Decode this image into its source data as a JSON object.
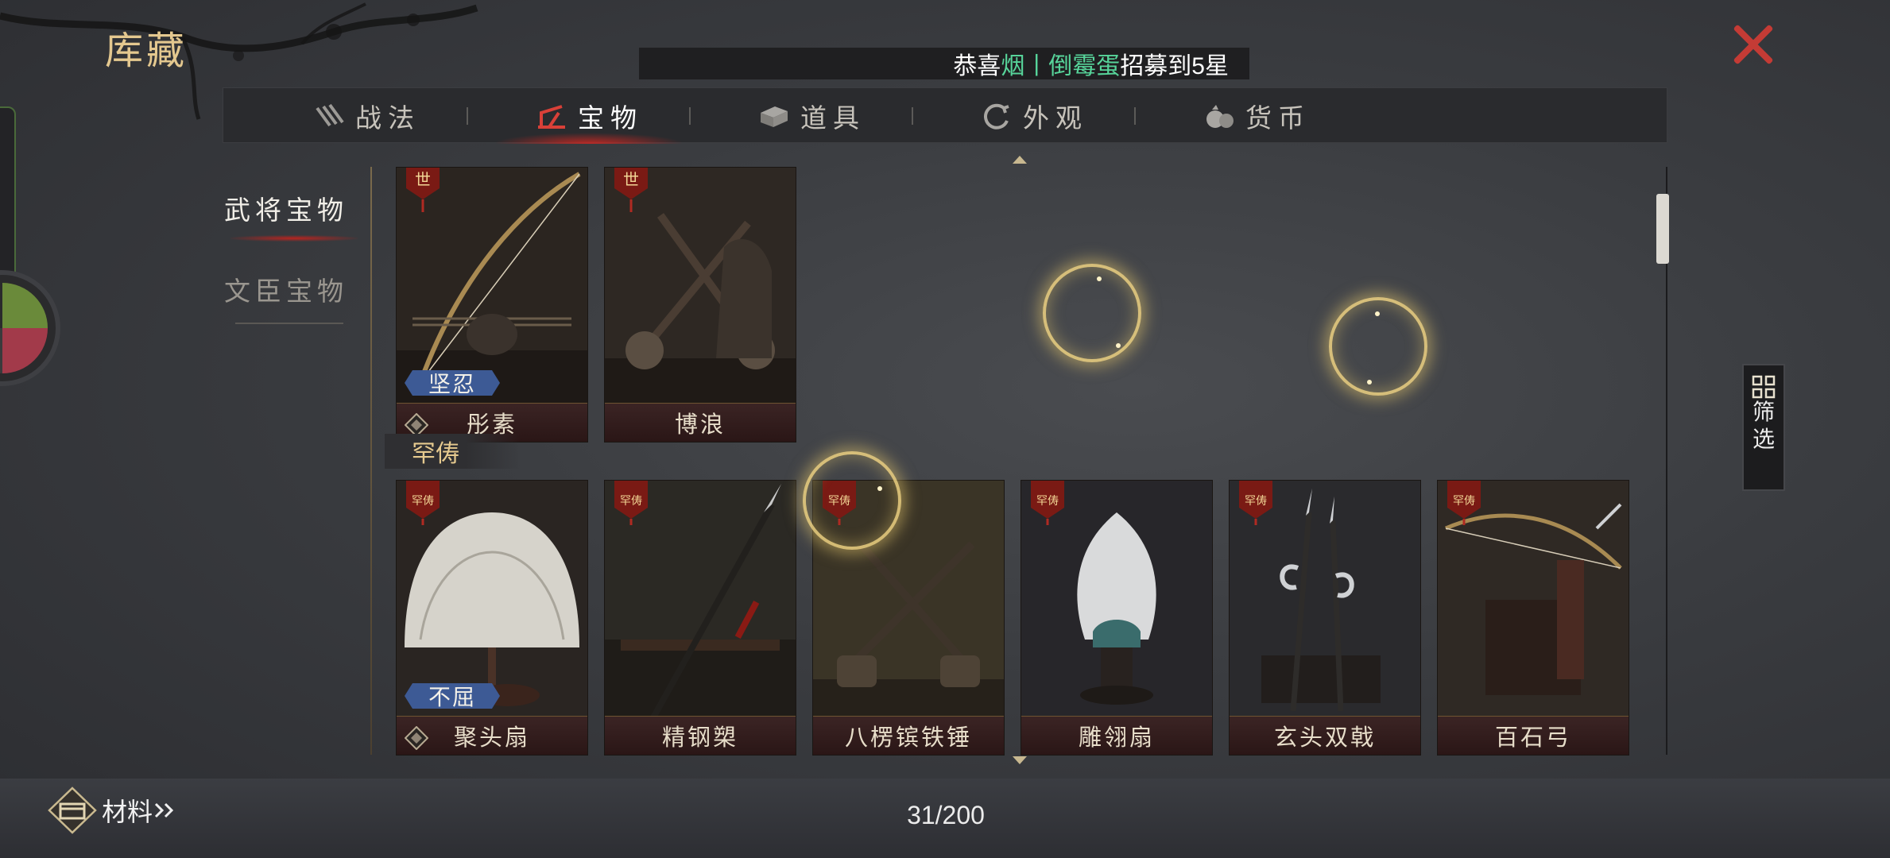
{
  "header": {
    "title": "库藏",
    "close_icon": "close-icon"
  },
  "ticker": {
    "prefix": "恭喜",
    "player": "烟丨倒霉蛋",
    "suffix": "招募到5星"
  },
  "tabs": [
    {
      "label": "战法",
      "icon": "scroll-bundle-icon"
    },
    {
      "label": "宝物",
      "icon": "treasure-icon"
    },
    {
      "label": "道具",
      "icon": "item-box-icon"
    },
    {
      "label": "外观",
      "icon": "swirl-icon"
    },
    {
      "label": "货币",
      "icon": "money-bag-icon"
    }
  ],
  "active_tab": "宝物",
  "sidebar": [
    {
      "label": "武将宝物"
    },
    {
      "label": "文臣宝物"
    }
  ],
  "active_sidebar": "武将宝物",
  "sections": [
    {
      "header": "",
      "rank_badge": "世",
      "items": [
        {
          "name": "彤素",
          "trait": "坚忍",
          "rank_icon": "diamond-rank-icon",
          "art": "bow-icon"
        },
        {
          "name": "博浪",
          "trait": "",
          "rank_icon": "",
          "art": "crossed-hammers-icon"
        }
      ]
    },
    {
      "header": "罕俦",
      "rank_badge": "罕俦",
      "items": [
        {
          "name": "聚头扇",
          "trait": "不屈",
          "rank_icon": "diamond-rank-icon",
          "art": "feather-fan-icon"
        },
        {
          "name": "精钢槊",
          "trait": "",
          "rank_icon": "",
          "art": "spear-icon"
        },
        {
          "name": "八楞镔铁锤",
          "trait": "",
          "rank_icon": "",
          "art": "crossed-hammers-icon"
        },
        {
          "name": "雕翎扇",
          "trait": "",
          "rank_icon": "",
          "art": "feather-fan-icon"
        },
        {
          "name": "玄头双戟",
          "trait": "",
          "rank_icon": "",
          "art": "halberds-icon"
        },
        {
          "name": "百石弓",
          "trait": "",
          "rank_icon": "",
          "art": "bow-icon"
        }
      ]
    }
  ],
  "filter": {
    "line1": "筛",
    "line2": "选",
    "icon": "grid-filter-icon"
  },
  "footer": {
    "materials_label": "材料",
    "materials_icon": "materials-chest-icon",
    "count": "31/200"
  },
  "colors": {
    "accent_gold": "#e4c88f",
    "close_red": "#c43b35",
    "ticker_green": "#57d49a",
    "card_frame": "#25211e"
  }
}
